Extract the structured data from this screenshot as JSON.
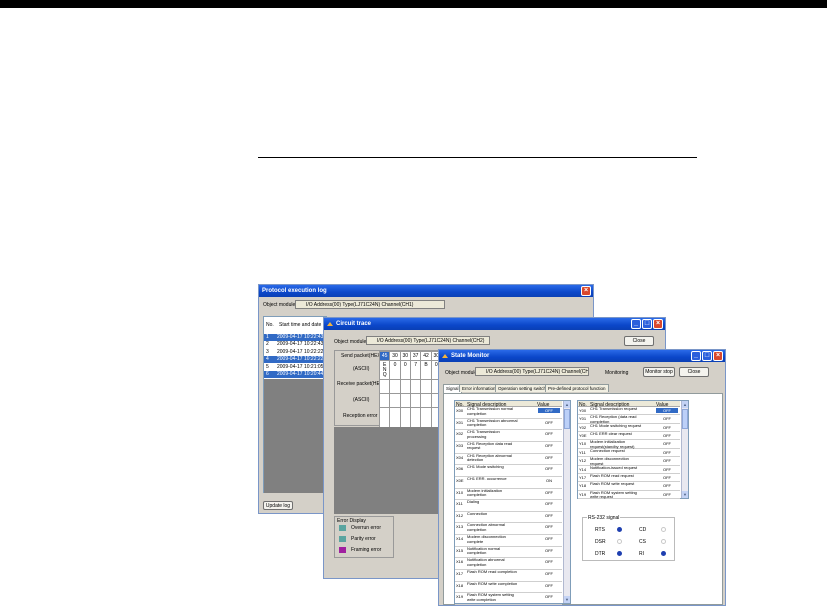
{
  "colors": {
    "titlebar": "#0b47c9",
    "selected_row": "#316ac5",
    "status_on": "#1e3fb0"
  },
  "log_window": {
    "title": "Protocol execution log",
    "object_module_label": "Object module",
    "object_module_value": "I/O Address(00) Type(LJ71C24N) Channel(CH1)",
    "col_no": "No.",
    "col_datetime": "Start time and date",
    "rows": [
      {
        "no": "1",
        "dt": "2009-04-17 10:22:43"
      },
      {
        "no": "2",
        "dt": "2009-04-17 10:22:43"
      },
      {
        "no": "3",
        "dt": "2009-04-17 10:22:22"
      },
      {
        "no": "4",
        "dt": "2009-04-17 10:22:22"
      },
      {
        "no": "5",
        "dt": "2009-04-17 10:21:05"
      },
      {
        "no": "6",
        "dt": "2009-04-17 10:20:44"
      }
    ],
    "update_button": "Update log"
  },
  "trace_window": {
    "title": "Circuit trace",
    "object_module_label": "Object module",
    "object_module_value": "I/O Address(00) Type(LJ71C24N) Channel(CH2)",
    "close_button": "Close",
    "send_hex_label": "Send packet(HEX)",
    "send_hex_values": [
      "45",
      "30",
      "30",
      "37",
      "42",
      "30"
    ],
    "ascii_label": "(ASCII)",
    "send_ascii_values": [
      "E\nN\nQ",
      "0",
      "0",
      "7",
      "B",
      "0"
    ],
    "recv_hex_label": "Receive packet(HEX)",
    "recv_ascii_label": "(ASCII)",
    "recv_error_label": "Reception error",
    "error_display": {
      "title": "Error Display",
      "items": [
        {
          "label": "Overrun error",
          "color": "#5aa5a0"
        },
        {
          "label": "Parity error",
          "color": "#5aa5a0"
        },
        {
          "label": "Framing error",
          "color": "#a020a0"
        }
      ]
    }
  },
  "monitor_window": {
    "title": "State Monitor",
    "object_module_label": "Object module",
    "object_module_value": "I/O Address(00) Type(LJ71C24N) Channel(CH1)",
    "monitoring_label": "Monitoring",
    "monitor_stop_button": "Monitor stop",
    "close_button": "Close",
    "tabs": [
      "Signal",
      "Error information",
      "Operation setting switch",
      "Pre-defined protocol function"
    ],
    "x_header": {
      "no": "No.",
      "desc": "Signal description",
      "value": "Value"
    },
    "x_signals": [
      {
        "no": "X00",
        "desc": "CH1 Transmission normal completion",
        "value": "OFF"
      },
      {
        "no": "X01",
        "desc": "CH1 Transmission abnormal completion",
        "value": "OFF"
      },
      {
        "no": "X02",
        "desc": "CH1 Transmission processing",
        "value": "OFF"
      },
      {
        "no": "X03",
        "desc": "CH1 Reception data read request",
        "value": "OFF"
      },
      {
        "no": "X04",
        "desc": "CH1 Reception abnormal detection",
        "value": "OFF"
      },
      {
        "no": "X06",
        "desc": "CH1 Mode switching",
        "value": "OFF"
      },
      {
        "no": "X0E",
        "desc": "CH1 ERR. occurrence",
        "value": "ON"
      },
      {
        "no": "X10",
        "desc": "Modem initialization completion",
        "value": "OFF"
      },
      {
        "no": "X11",
        "desc": "Dialing",
        "value": "OFF"
      },
      {
        "no": "X12",
        "desc": "Connection",
        "value": "OFF"
      },
      {
        "no": "X13",
        "desc": "Connection abnormal completion",
        "value": "OFF"
      },
      {
        "no": "X14",
        "desc": "Modem disconnection complete",
        "value": "OFF"
      },
      {
        "no": "X15",
        "desc": "Notification normal completion",
        "value": "OFF"
      },
      {
        "no": "X16",
        "desc": "Notification abnormal completion",
        "value": "OFF"
      },
      {
        "no": "X17",
        "desc": "Flash ROM read completion",
        "value": "OFF"
      },
      {
        "no": "X18",
        "desc": "Flash ROM write completion",
        "value": "OFF"
      },
      {
        "no": "X19",
        "desc": "Flash ROM system setting write completion",
        "value": "OFF"
      }
    ],
    "y_header": {
      "no": "No.",
      "desc": "Signal description",
      "value": "Value"
    },
    "y_signals": [
      {
        "no": "Y00",
        "desc": "CH1 Transmission request",
        "value": "OFF"
      },
      {
        "no": "Y01",
        "desc": "CH1 Reception (data read completion",
        "value": "OFF"
      },
      {
        "no": "Y02",
        "desc": "CH1 Mode switching request",
        "value": "OFF"
      },
      {
        "no": "Y0E",
        "desc": "CH1 ERR clear request",
        "value": "OFF"
      },
      {
        "no": "Y10",
        "desc": "Modem initialization request(standby request)",
        "value": "OFF"
      },
      {
        "no": "Y11",
        "desc": "Connection request",
        "value": "OFF"
      },
      {
        "no": "Y12",
        "desc": "Modem disconnection request",
        "value": "OFF"
      },
      {
        "no": "Y14",
        "desc": "Notification-issued request",
        "value": "OFF"
      },
      {
        "no": "Y17",
        "desc": "Flash ROM read request",
        "value": "OFF"
      },
      {
        "no": "Y18",
        "desc": "Flash ROM write request",
        "value": "OFF"
      },
      {
        "no": "Y19",
        "desc": "Flash ROM system setting write request",
        "value": "OFF"
      }
    ],
    "rs232": {
      "title": "RS-232 signal",
      "signals": [
        {
          "label": "RTS",
          "on": true
        },
        {
          "label": "CD",
          "on": false
        },
        {
          "label": "DSR",
          "on": false
        },
        {
          "label": "CS",
          "on": false
        },
        {
          "label": "DTR",
          "on": true
        },
        {
          "label": "RI",
          "on": true
        }
      ]
    }
  }
}
